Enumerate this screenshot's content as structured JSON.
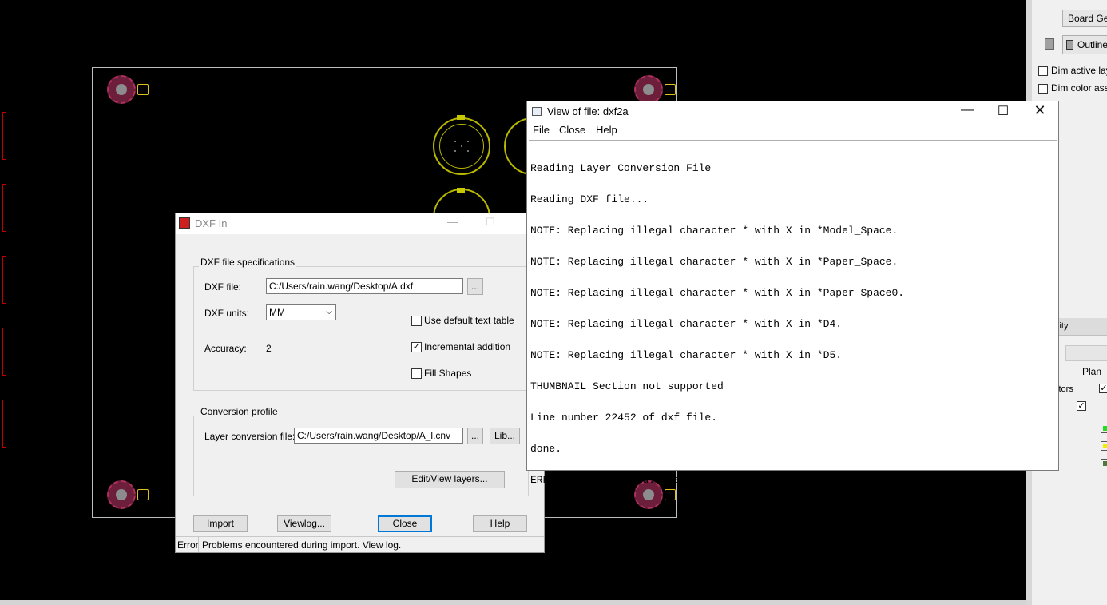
{
  "right_panel": {
    "board_geometry_button": "Board Geor",
    "outline_label": "Outline",
    "dim_active_layer": "Dim active laye",
    "dim_color_assign": "Dim color assig",
    "section_fragment": "lity",
    "plan_link": "Plan",
    "plan_link_fragment": "E",
    "connectors_fragment": "ctors",
    "swatch_colors": [
      "#22dd22",
      "#eeee00",
      "#4c7a3c"
    ]
  },
  "dxf_dialog": {
    "title": "DXF In",
    "file_group_label": "DXF file specifications",
    "dxf_file_label": "DXF file:",
    "dxf_file_value": "C:/Users/rain.wang/Desktop/A.dxf",
    "browse_label": "...",
    "dxf_units_label": "DXF units:",
    "dxf_units_value": "MM",
    "accuracy_label": "Accuracy:",
    "accuracy_value": "2",
    "use_default_text_table": "Use default text table",
    "incremental_addition": "Incremental addition",
    "fill_shapes": "Fill Shapes",
    "checked": {
      "use_default_text_table": false,
      "incremental_addition": true,
      "fill_shapes": false
    },
    "profile_group_label": "Conversion profile",
    "layer_conv_label": "Layer conversion file:",
    "layer_conv_value": "C:/Users/rain.wang/Desktop/A_l.cnv",
    "layer_browse_label": "...",
    "lib_button": "Lib...",
    "edit_view_layers_button": "Edit/View layers...",
    "import_button": "Import",
    "viewlog_button": "Viewlog...",
    "close_button": "Close",
    "help_button": "Help",
    "status_kind": "Error",
    "status_message": "Problems encountered during import. View log."
  },
  "view_window": {
    "title": "View of file: dxf2a",
    "menu": {
      "file": "File",
      "close": "Close",
      "help": "Help"
    },
    "lines": [
      "Reading Layer Conversion File",
      "Reading DXF file...",
      "NOTE: Replacing illegal character * with X in *Model_Space.",
      "NOTE: Replacing illegal character * with X in *Paper_Space.",
      "NOTE: Replacing illegal character * with X in *Paper_Space0.",
      "NOTE: Replacing illegal character * with X in *D4.",
      "NOTE: Replacing illegal character * with X in *D5.",
      "THUMBNAIL Section not supported",
      "Line number 22452 of dxf file.",
      "done.",
      "ERROR: No data read.  Terminating program."
    ]
  }
}
